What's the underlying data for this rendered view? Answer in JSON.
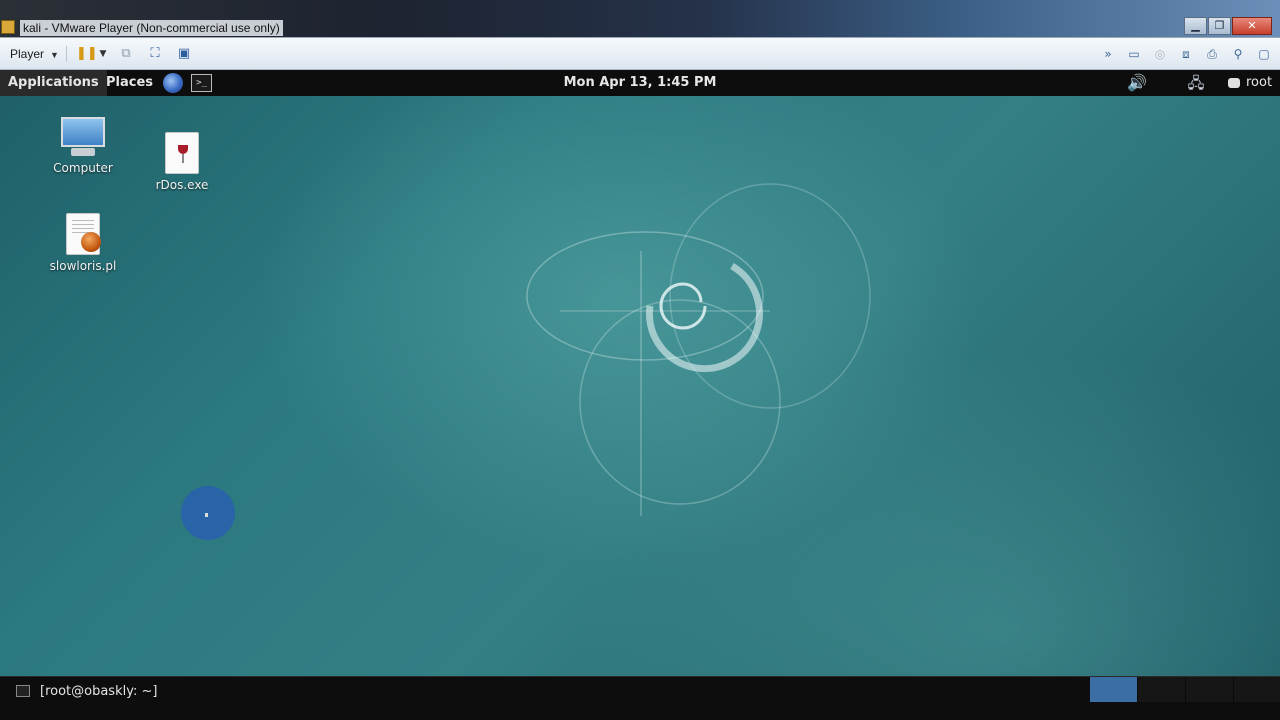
{
  "vm_window": {
    "title": "kali - VMware Player (Non-commercial use only)",
    "controls": {
      "minimize": "▁",
      "maximize": "❐",
      "close": "✕"
    }
  },
  "vm_toolbar": {
    "player_label": "Player",
    "icons": [
      "pause-icon",
      "dropdown-caret-icon",
      "send-ctrl-alt-del-icon",
      "fullscreen-icon",
      "unity-icon"
    ],
    "right_icons": [
      "more-icon",
      "hard-disk-icon",
      "cd-icon",
      "network-adapter-icon",
      "printer-icon",
      "usb-icon",
      "message-icon"
    ]
  },
  "panel": {
    "applications_label": "Applications",
    "places_label": "Places",
    "clock": "Mon Apr 13,  1:45 PM",
    "user": "root",
    "terminal_glyph": ">_"
  },
  "desktop": {
    "icons": [
      {
        "label": "Computer",
        "icon": "computer-icon"
      },
      {
        "label": "rDos.exe",
        "icon": "wine-exe-icon"
      },
      {
        "label": "slowloris.pl",
        "icon": "perl-script-icon"
      }
    ]
  },
  "taskbar": {
    "task_label": "[root@obaskly: ~]",
    "workspaces": 4,
    "active_workspace": 1
  },
  "colors": {
    "desktop_bg": "#2b7a80",
    "panel_bg": "#0d0d0d",
    "active_workspace": "#3b6ea5"
  }
}
